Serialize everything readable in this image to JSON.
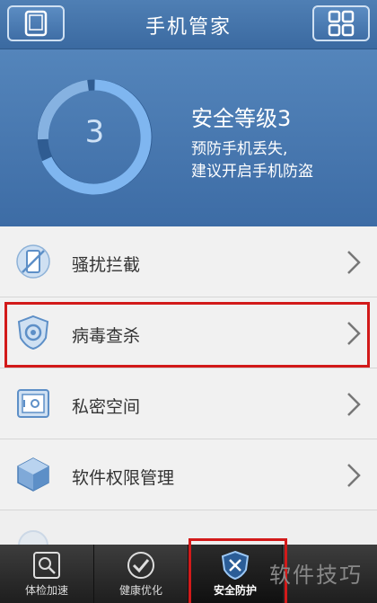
{
  "header": {
    "title": "手机管家",
    "left_icon": "phone-icon",
    "right_icon": "grid-icon"
  },
  "hero": {
    "level_number": "3",
    "title": "安全等级3",
    "line1": "预防手机丢失,",
    "line2": "建议开启手机防盗"
  },
  "list": {
    "items": [
      {
        "label": "骚扰拦截",
        "icon": "phone-block-icon"
      },
      {
        "label": "病毒查杀",
        "icon": "shield-target-icon"
      },
      {
        "label": "私密空间",
        "icon": "safe-icon"
      },
      {
        "label": "软件权限管理",
        "icon": "cube-icon"
      }
    ]
  },
  "nav": {
    "tabs": [
      {
        "label": "体检加速",
        "icon": "magnifier-icon"
      },
      {
        "label": "健康优化",
        "icon": "check-circle-icon"
      },
      {
        "label": "安全防护",
        "icon": "shield-x-icon",
        "active": true
      }
    ]
  },
  "watermark": "软件技巧",
  "colors": {
    "accent": "#3d6ca5",
    "highlight": "#d21a1a"
  }
}
